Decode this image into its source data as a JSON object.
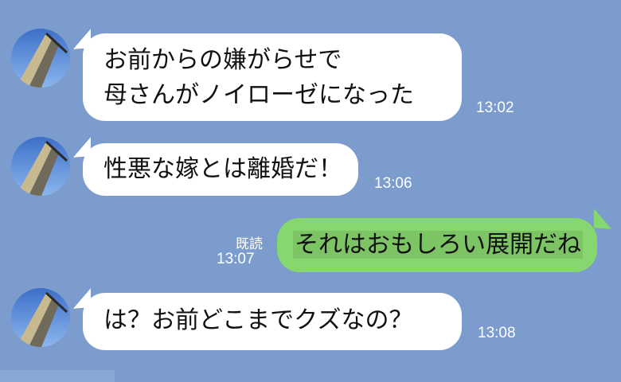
{
  "messages": [
    {
      "side": "left",
      "lines": [
        "お前からの嫌がらせで",
        "母さんがノイローゼになった"
      ],
      "time": "13:02"
    },
    {
      "side": "left",
      "lines": [
        "性悪な嫁とは離婚だ！"
      ],
      "time": "13:06"
    },
    {
      "side": "right",
      "lines": [
        "それはおもしろい展開だね"
      ],
      "read": "既読",
      "time": "13:07"
    },
    {
      "side": "left",
      "lines": [
        "は？お前どこまでクズなの？"
      ],
      "time": "13:08"
    }
  ],
  "colors": {
    "background": "#7b9ccd",
    "incoming_bubble": "#ffffff",
    "outgoing_bubble": "#86d86e"
  },
  "icons": {
    "avatar": "avatar-tower-photo"
  }
}
